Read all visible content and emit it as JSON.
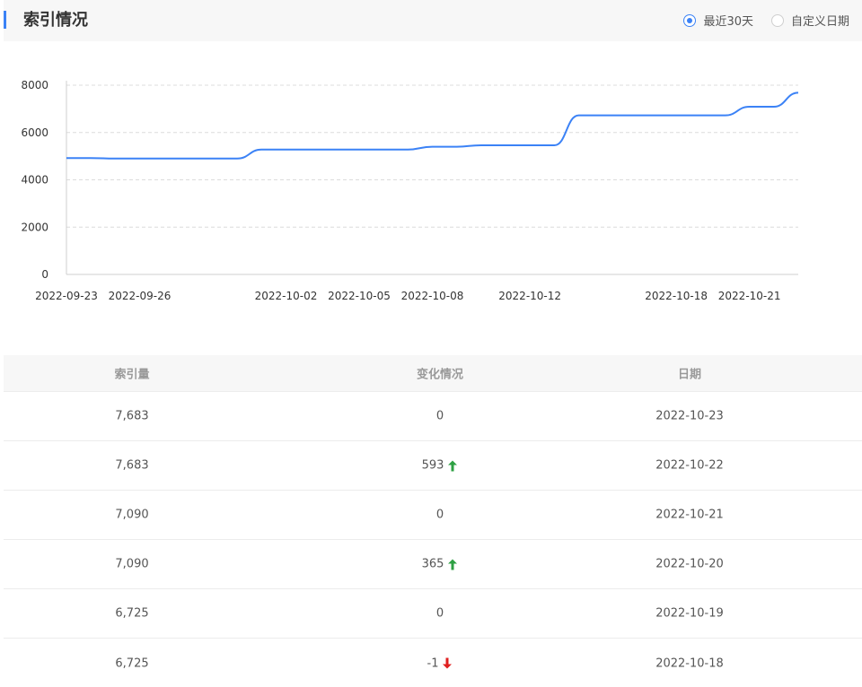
{
  "header": {
    "title": "索引情况",
    "radio_options": [
      {
        "label": "最近30天",
        "checked": true
      },
      {
        "label": "自定义日期",
        "checked": false
      }
    ]
  },
  "colors": {
    "accent": "#3b82f6",
    "up": "#2ea043",
    "down": "#e02020"
  },
  "chart_data": {
    "type": "line",
    "x": [
      "2022-09-23",
      "2022-09-24",
      "2022-09-25",
      "2022-09-26",
      "2022-09-27",
      "2022-09-28",
      "2022-09-29",
      "2022-09-30",
      "2022-10-01",
      "2022-10-02",
      "2022-10-03",
      "2022-10-04",
      "2022-10-05",
      "2022-10-06",
      "2022-10-07",
      "2022-10-08",
      "2022-10-09",
      "2022-10-10",
      "2022-10-11",
      "2022-10-12",
      "2022-10-13",
      "2022-10-14",
      "2022-10-15",
      "2022-10-16",
      "2022-10-17",
      "2022-10-18",
      "2022-10-19",
      "2022-10-20",
      "2022-10-21",
      "2022-10-22",
      "2022-10-23"
    ],
    "series": [
      {
        "values": [
          4920,
          4920,
          4900,
          4900,
          4900,
          4900,
          4900,
          4900,
          5280,
          5280,
          5280,
          5280,
          5280,
          5280,
          5280,
          5400,
          5400,
          5460,
          5460,
          5460,
          5460,
          6725,
          6725,
          6725,
          6725,
          6725,
          6726,
          6725,
          7090,
          7090,
          7683
        ]
      }
    ],
    "xticks": [
      "2022-09-23",
      "2022-09-26",
      "2022-10-02",
      "2022-10-05",
      "2022-10-08",
      "2022-10-12",
      "2022-10-18",
      "2022-10-21"
    ],
    "yticks": [
      0,
      2000,
      4000,
      6000,
      8000
    ],
    "ylim": [
      0,
      8000
    ],
    "grid": true,
    "color": "#3b82f6"
  },
  "table": {
    "headers": [
      "索引量",
      "变化情况",
      "日期"
    ],
    "rows": [
      {
        "count": "7,683",
        "change": "0",
        "trend": "none",
        "date": "2022-10-23"
      },
      {
        "count": "7,683",
        "change": "593",
        "trend": "up",
        "date": "2022-10-22"
      },
      {
        "count": "7,090",
        "change": "0",
        "trend": "none",
        "date": "2022-10-21"
      },
      {
        "count": "7,090",
        "change": "365",
        "trend": "up",
        "date": "2022-10-20"
      },
      {
        "count": "6,725",
        "change": "0",
        "trend": "none",
        "date": "2022-10-19"
      },
      {
        "count": "6,725",
        "change": "-1",
        "trend": "down",
        "date": "2022-10-18"
      }
    ]
  }
}
